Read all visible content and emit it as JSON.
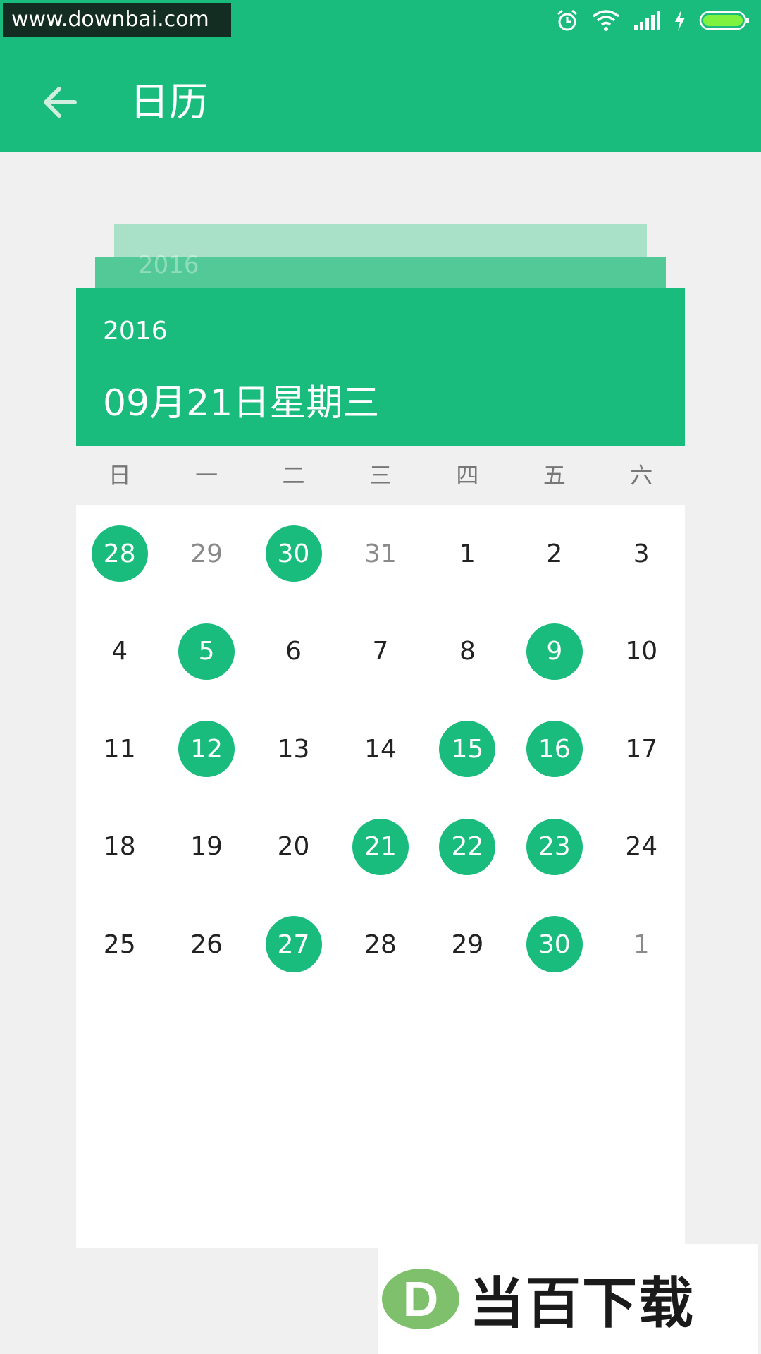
{
  "status_bar": {
    "watermark_text": "www.downbai.com",
    "icons": [
      "alarm-icon",
      "wifi-icon",
      "signal-icon",
      "charging-icon",
      "battery-icon"
    ]
  },
  "toolbar": {
    "title": "日历",
    "back_icon": "arrow-left-icon"
  },
  "header": {
    "ghost_year": "2016",
    "year": "2016",
    "date": "09月21日星期三"
  },
  "weekdays": [
    "日",
    "一",
    "二",
    "三",
    "四",
    "五",
    "六"
  ],
  "days": [
    {
      "label": "28",
      "muted": false,
      "marked": true
    },
    {
      "label": "29",
      "muted": true,
      "marked": false
    },
    {
      "label": "30",
      "muted": false,
      "marked": true
    },
    {
      "label": "31",
      "muted": true,
      "marked": false
    },
    {
      "label": "1",
      "muted": false,
      "marked": false
    },
    {
      "label": "2",
      "muted": false,
      "marked": false
    },
    {
      "label": "3",
      "muted": false,
      "marked": false
    },
    {
      "label": "4",
      "muted": false,
      "marked": false
    },
    {
      "label": "5",
      "muted": false,
      "marked": true
    },
    {
      "label": "6",
      "muted": false,
      "marked": false
    },
    {
      "label": "7",
      "muted": false,
      "marked": false
    },
    {
      "label": "8",
      "muted": false,
      "marked": false
    },
    {
      "label": "9",
      "muted": false,
      "marked": true
    },
    {
      "label": "10",
      "muted": false,
      "marked": false
    },
    {
      "label": "11",
      "muted": false,
      "marked": false
    },
    {
      "label": "12",
      "muted": false,
      "marked": true
    },
    {
      "label": "13",
      "muted": false,
      "marked": false
    },
    {
      "label": "14",
      "muted": false,
      "marked": false
    },
    {
      "label": "15",
      "muted": false,
      "marked": true
    },
    {
      "label": "16",
      "muted": false,
      "marked": true
    },
    {
      "label": "17",
      "muted": false,
      "marked": false
    },
    {
      "label": "18",
      "muted": false,
      "marked": false
    },
    {
      "label": "19",
      "muted": false,
      "marked": false
    },
    {
      "label": "20",
      "muted": false,
      "marked": false
    },
    {
      "label": "21",
      "muted": false,
      "marked": true
    },
    {
      "label": "22",
      "muted": false,
      "marked": true
    },
    {
      "label": "23",
      "muted": false,
      "marked": true
    },
    {
      "label": "24",
      "muted": false,
      "marked": false
    },
    {
      "label": "25",
      "muted": false,
      "marked": false
    },
    {
      "label": "26",
      "muted": false,
      "marked": false
    },
    {
      "label": "27",
      "muted": false,
      "marked": true
    },
    {
      "label": "28",
      "muted": false,
      "marked": false
    },
    {
      "label": "29",
      "muted": false,
      "marked": false
    },
    {
      "label": "30",
      "muted": false,
      "marked": true
    },
    {
      "label": "1",
      "muted": true,
      "marked": false
    }
  ],
  "bottom_watermark": {
    "logo_letter": "D",
    "text": "当百下载"
  },
  "colors": {
    "accent": "#19bc7c",
    "background": "#f0f0f0",
    "card": "#ffffff",
    "muted_text": "#8a8a8a"
  }
}
